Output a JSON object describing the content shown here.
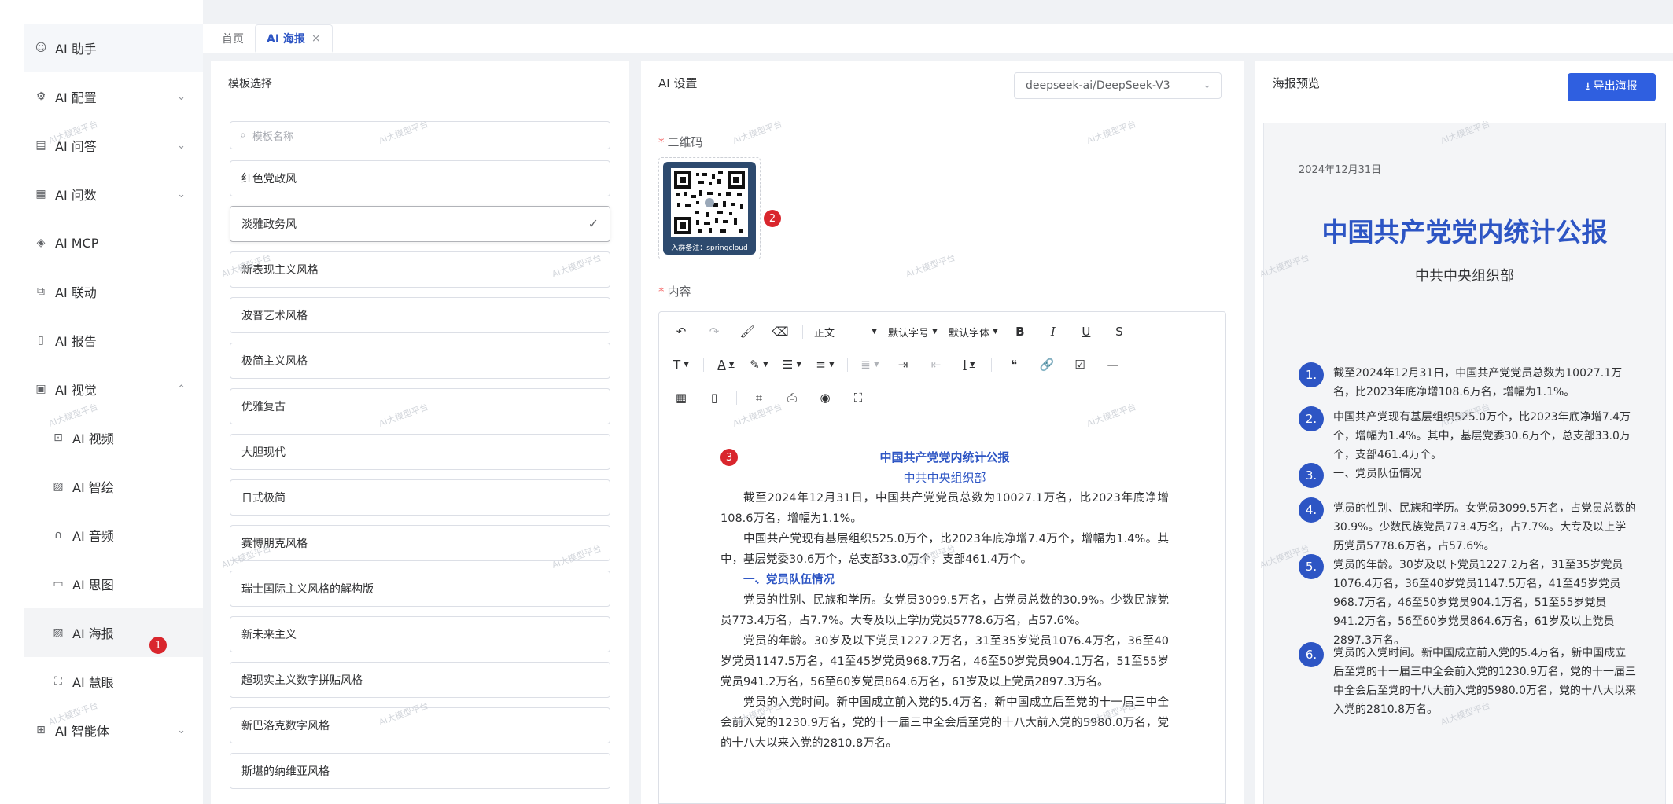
{
  "sidebar": {
    "items": [
      {
        "label": "AI 助手",
        "icon": "robot-icon",
        "chevron": ""
      },
      {
        "label": "AI 配置",
        "icon": "gear-icon",
        "chevron": "⌄"
      },
      {
        "label": "AI 问答",
        "icon": "chat-icon",
        "chevron": "⌄"
      },
      {
        "label": "AI 问数",
        "icon": "chart-icon",
        "chevron": "⌄"
      },
      {
        "label": "AI MCP",
        "icon": "plug-icon",
        "chevron": ""
      },
      {
        "label": "AI 联动",
        "icon": "link-icon",
        "chevron": ""
      },
      {
        "label": "AI 报告",
        "icon": "report-icon",
        "chevron": ""
      },
      {
        "label": "AI 视觉",
        "icon": "camera-icon",
        "chevron": "⌃"
      }
    ],
    "sub_items": [
      {
        "label": "AI 视频",
        "icon": "video-icon"
      },
      {
        "label": "AI 智绘",
        "icon": "image-icon"
      },
      {
        "label": "AI 音频",
        "icon": "headphone-icon"
      },
      {
        "label": "AI 思图",
        "icon": "mindmap-icon"
      },
      {
        "label": "AI 海报",
        "icon": "poster-icon"
      },
      {
        "label": "AI 慧眼",
        "icon": "scan-icon"
      }
    ],
    "last_item": {
      "label": "AI 智能体",
      "icon": "agent-icon",
      "chevron": "⌄"
    }
  },
  "badges": {
    "one": "1",
    "two": "2",
    "three": "3"
  },
  "tabs": [
    {
      "label": "首页"
    },
    {
      "label": "AI 海报",
      "close": "×"
    }
  ],
  "template_panel": {
    "title": "模板选择",
    "search_placeholder": "模板名称",
    "items": [
      "红色党政风",
      "淡雅政务风",
      "新表现主义风格",
      "波普艺术风格",
      "极简主义风格",
      "优雅复古",
      "大胆现代",
      "日式极简",
      "赛博朋克风格",
      "瑞士国际主义风格的解构版",
      "新未来主义",
      "超现实主义数字拼贴风格",
      "新巴洛克数字风格",
      "斯堪的纳维亚风格"
    ],
    "selected_index": 1
  },
  "ai_panel": {
    "title": "AI 设置",
    "model": "deepseek-ai/DeepSeek-V3",
    "qr_label": "二维码",
    "qr_required": "*",
    "qr_caption": "入群备注：springcloud",
    "content_label": "内容",
    "content_required": "*",
    "toolbar": {
      "paragraph": "正文",
      "font_size": "默认字号",
      "font_family": "默认字体"
    },
    "doc": {
      "title": "中国共产党党内统计公报",
      "subtitle": "中共中央组织部",
      "p1": "截至2024年12月31日，中国共产党党员总数为10027.1万名，比2023年底净增108.6万名，增幅为1.1%。",
      "p2": "中国共产党现有基层组织525.0万个，比2023年底净增7.4万个，增幅为1.4%。其中，基层党委30.6万个，总支部33.0万个，支部461.4万个。",
      "section1": "一、党员队伍情况",
      "p3": "党员的性别、民族和学历。女党员3099.5万名，占党员总数的30.9%。少数民族党员773.4万名，占7.7%。大专及以上学历党员5778.6万名，占57.6%。",
      "p4": "党员的年龄。30岁及以下党员1227.2万名，31至35岁党员1076.4万名，36至40岁党员1147.5万名，41至45岁党员968.7万名，46至50岁党员904.1万名，51至55岁党员941.2万名，56至60岁党员864.6万名，61岁及以上党员2897.3万名。",
      "p5": "党员的入党时间。新中国成立前入党的5.4万名，新中国成立后至党的十一届三中全会前入党的1230.9万名，党的十一届三中全会后至党的十八大前入党的5980.0万名，党的十八大以来入党的2810.8万名。"
    }
  },
  "preview_panel": {
    "title": "海报预览",
    "export_label": "⭳ 导出海报",
    "date": "2024年12月31日",
    "poster_title": "中国共产党党内统计公报",
    "poster_subtitle": "中共中央组织部",
    "items": [
      {
        "num": "1.",
        "text": "截至2024年12月31日，中国共产党党员总数为10027.1万名，比2023年底净增108.6万名，增幅为1.1%。"
      },
      {
        "num": "2.",
        "text": "中国共产党现有基层组织525.0万个，比2023年底净增7.4万个，增幅为1.4%。其中，基层党委30.6万个，总支部33.0万个，支部461.4万个。"
      },
      {
        "num": "3.",
        "text": "一、党员队伍情况"
      },
      {
        "num": "4.",
        "text": "党员的性别、民族和学历。女党员3099.5万名，占党员总数的30.9%。少数民族党员773.4万名，占7.7%。大专及以上学历党员5778.6万名，占57.6%。"
      },
      {
        "num": "5.",
        "text": "党员的年龄。30岁及以下党员1227.2万名，31至35岁党员1076.4万名，36至40岁党员1147.5万名，41至45岁党员968.7万名，46至50岁党员904.1万名，51至55岁党员941.2万名，56至60岁党员864.6万名，61岁及以上党员2897.3万名。"
      },
      {
        "num": "6.",
        "text": "党员的入党时间。新中国成立前入党的5.4万名，新中国成立后至党的十一届三中全会前入党的1230.9万名，党的十一届三中全会后至党的十八大前入党的5980.0万名，党的十八大以来入党的2810.8万名。"
      }
    ]
  },
  "watermark": "AI大模型平台",
  "colors": {
    "accent": "#2d55c4",
    "primary_button": "#2f5fe0",
    "badge": "#d9262d"
  }
}
